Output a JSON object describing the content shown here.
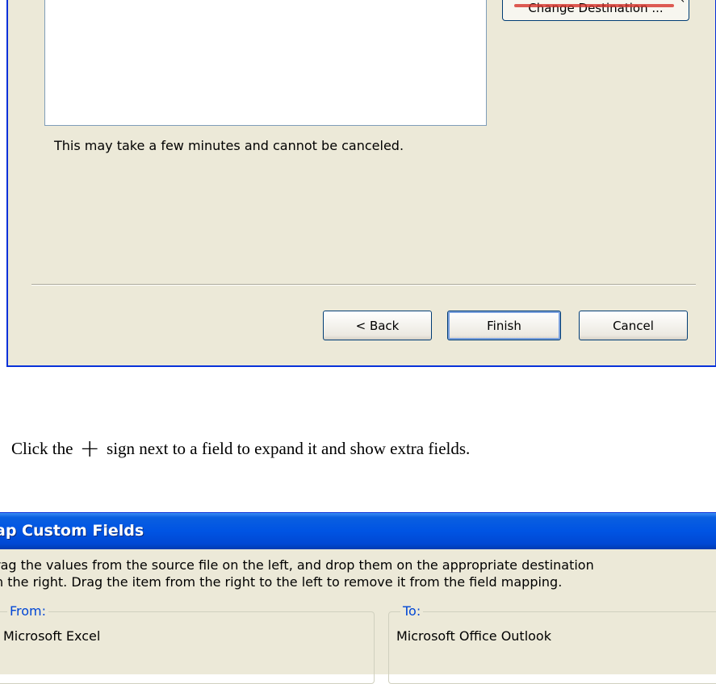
{
  "wizard": {
    "change_destination_label": "Change Destination ...",
    "note": "This may take a few minutes and cannot be canceled.",
    "back_label": "< Back",
    "finish_label": "Finish",
    "cancel_label": "Cancel"
  },
  "instruction": {
    "before": "Click the",
    "plus": "+",
    "after": "sign next to a field to expand it and show extra fields."
  },
  "map_dialog": {
    "title": "ap Custom Fields",
    "description_line1": "rag the values from the source file on the left, and drop them on the appropriate destination",
    "description_line2": "n the right.  Drag the item from the right to the left to remove it from the field mapping.",
    "from_label": "From:",
    "from_source": "Microsoft Excel",
    "to_label": "To:",
    "to_source": "Microsoft Office Outlook"
  },
  "colors": {
    "dialog_bg": "#ece9d8",
    "titlebar_blue": "#0054e3",
    "annotation_red": "#d6332a",
    "group_label_blue": "#0046d5"
  }
}
